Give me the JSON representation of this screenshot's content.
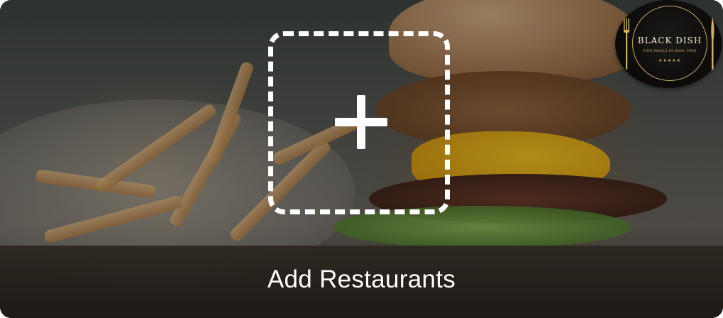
{
  "logo": {
    "title": "BLACK DISH",
    "tagline": "FINE MEALS IN REAL TIME",
    "stars": "★★★★★"
  },
  "add_button": {
    "icon": "plus-icon"
  },
  "bottom": {
    "label": "Add Restaurants"
  },
  "colors": {
    "dash": "#ffffff",
    "logo_gold": "#cfae6f",
    "bar": "#2d2620"
  }
}
